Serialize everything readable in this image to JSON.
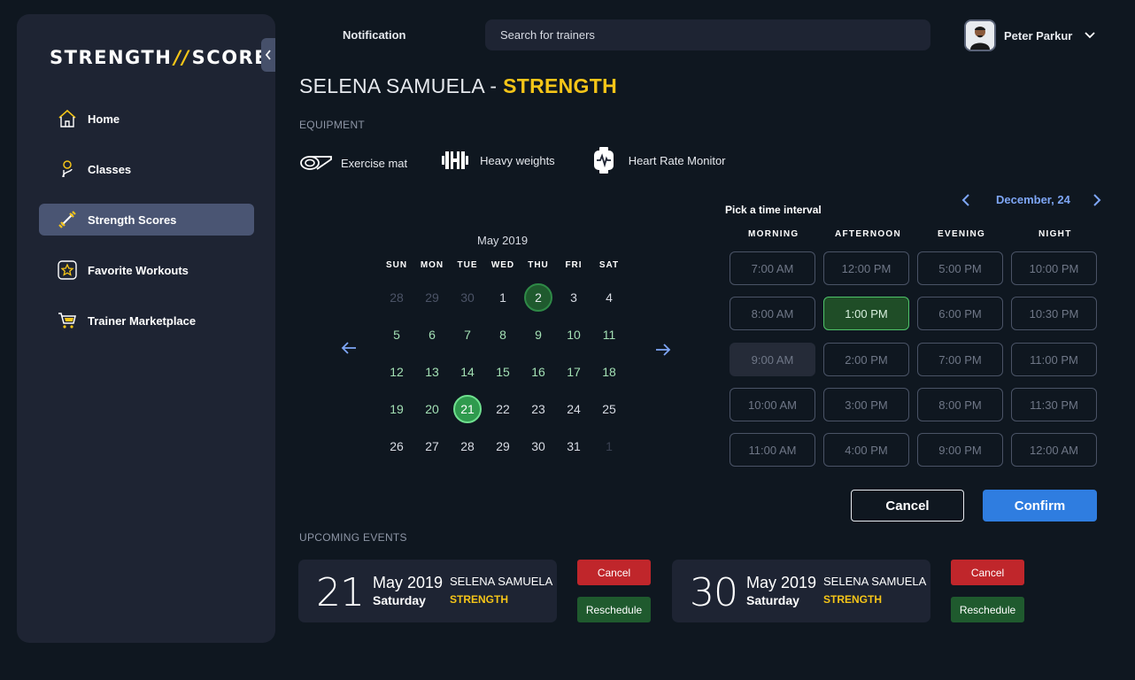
{
  "sidebar": {
    "logo_left": "STRENGTH",
    "logo_sep": "//",
    "logo_right": "SCORE",
    "items": [
      {
        "label": "Home",
        "icon": "home-icon",
        "active": false
      },
      {
        "label": "Classes",
        "icon": "classes-icon",
        "active": false
      },
      {
        "label": "Strength Scores",
        "icon": "dumbbell-icon",
        "active": true
      },
      {
        "label": "Favorite Workouts",
        "icon": "star-icon",
        "active": false
      },
      {
        "label": "Trainer Marketplace",
        "icon": "cart-icon",
        "active": false
      }
    ]
  },
  "header": {
    "notification": "Notification",
    "search_placeholder": "Search for trainers",
    "user_name": "Peter Parkur"
  },
  "page": {
    "title_name": "SELENA SAMUELA - ",
    "title_class": "STRENGTH",
    "equipment_label": "EQUIPMENT",
    "equipment": [
      {
        "label": "Exercise mat",
        "icon": "mat-icon"
      },
      {
        "label": "Heavy weights",
        "icon": "weights-icon"
      },
      {
        "label": "Heart Rate Monitor",
        "icon": "heart-monitor-icon"
      }
    ]
  },
  "calendar": {
    "month": "May 2019",
    "weekdays": [
      "SUN",
      "MON",
      "TUE",
      "WED",
      "THU",
      "FRI",
      "SAT"
    ],
    "weeks": [
      [
        {
          "d": "28",
          "s": "muted"
        },
        {
          "d": "29",
          "s": "muted"
        },
        {
          "d": "30",
          "s": "muted"
        },
        {
          "d": "1",
          "s": ""
        },
        {
          "d": "2",
          "s": "today"
        },
        {
          "d": "3",
          "s": ""
        },
        {
          "d": "4",
          "s": ""
        }
      ],
      [
        {
          "d": "5",
          "s": "light"
        },
        {
          "d": "6",
          "s": "light"
        },
        {
          "d": "7",
          "s": "light"
        },
        {
          "d": "8",
          "s": "light"
        },
        {
          "d": "9",
          "s": "light"
        },
        {
          "d": "10",
          "s": "light"
        },
        {
          "d": "11",
          "s": "light"
        }
      ],
      [
        {
          "d": "12",
          "s": "light"
        },
        {
          "d": "13",
          "s": "light"
        },
        {
          "d": "14",
          "s": "light"
        },
        {
          "d": "15",
          "s": "light"
        },
        {
          "d": "16",
          "s": "light"
        },
        {
          "d": "17",
          "s": "light"
        },
        {
          "d": "18",
          "s": "light"
        }
      ],
      [
        {
          "d": "19",
          "s": "light"
        },
        {
          "d": "20",
          "s": "light"
        },
        {
          "d": "21",
          "s": "selected"
        },
        {
          "d": "22",
          "s": ""
        },
        {
          "d": "23",
          "s": ""
        },
        {
          "d": "24",
          "s": ""
        },
        {
          "d": "25",
          "s": ""
        }
      ],
      [
        {
          "d": "26",
          "s": ""
        },
        {
          "d": "27",
          "s": ""
        },
        {
          "d": "28",
          "s": ""
        },
        {
          "d": "29",
          "s": ""
        },
        {
          "d": "30",
          "s": ""
        },
        {
          "d": "31",
          "s": ""
        },
        {
          "d": "1",
          "s": "faint"
        }
      ]
    ]
  },
  "time_picker": {
    "label": "Pick a time interval",
    "date": "December, 24",
    "columns": [
      {
        "name": "MORNING",
        "slots": [
          {
            "t": "7:00 AM",
            "s": ""
          },
          {
            "t": "8:00 AM",
            "s": ""
          },
          {
            "t": "9:00 AM",
            "s": "disabled"
          },
          {
            "t": "10:00 AM",
            "s": ""
          },
          {
            "t": "11:00 AM",
            "s": ""
          }
        ]
      },
      {
        "name": "AFTERNOON",
        "slots": [
          {
            "t": "12:00 PM",
            "s": ""
          },
          {
            "t": "1:00 PM",
            "s": "selected"
          },
          {
            "t": "2:00 PM",
            "s": ""
          },
          {
            "t": "3:00 PM",
            "s": ""
          },
          {
            "t": "4:00 PM",
            "s": ""
          }
        ]
      },
      {
        "name": "EVENING",
        "slots": [
          {
            "t": "5:00 PM",
            "s": ""
          },
          {
            "t": "6:00 PM",
            "s": ""
          },
          {
            "t": "7:00 PM",
            "s": ""
          },
          {
            "t": "8:00 PM",
            "s": ""
          },
          {
            "t": "9:00 PM",
            "s": ""
          }
        ]
      },
      {
        "name": "NIGHT",
        "slots": [
          {
            "t": "10:00 PM",
            "s": ""
          },
          {
            "t": "10:30 PM",
            "s": ""
          },
          {
            "t": "11:00 PM",
            "s": ""
          },
          {
            "t": "11:30 PM",
            "s": ""
          },
          {
            "t": "12:00 AM",
            "s": ""
          }
        ]
      }
    ],
    "cancel_label": "Cancel",
    "confirm_label": "Confirm"
  },
  "events": {
    "label": "UPCOMING EVENTS",
    "items": [
      {
        "day": "21",
        "month": "May 2019",
        "weekday": "Saturday",
        "trainer": "SELENA SAMUELA",
        "class": "STRENGTH",
        "cancel": "Cancel",
        "reschedule": "Reschedule"
      },
      {
        "day": "30",
        "month": "May 2019",
        "weekday": "Saturday",
        "trainer": "SELENA SAMUELA",
        "class": "STRENGTH",
        "cancel": "Cancel",
        "reschedule": "Reschedule"
      }
    ]
  },
  "colors": {
    "accent_yellow": "#f5c518",
    "accent_blue": "#2f7de0",
    "success_green": "#2f9a4e",
    "danger_red": "#c0262b"
  }
}
